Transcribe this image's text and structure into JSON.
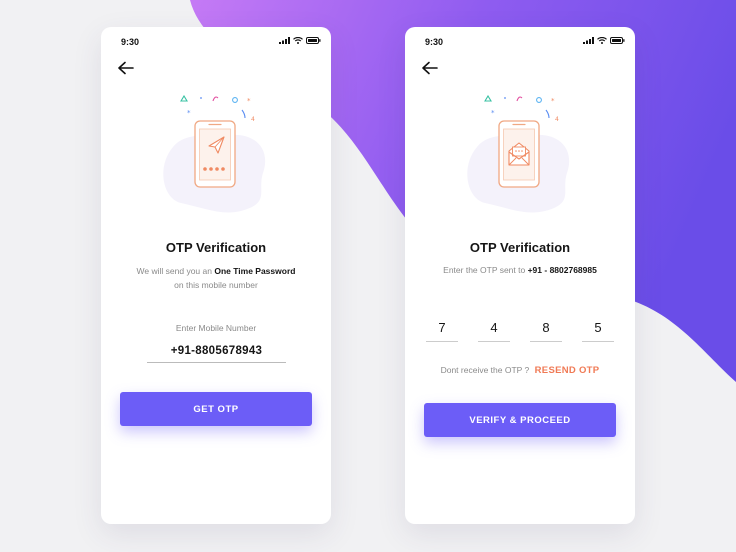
{
  "background": {
    "gradient_start": "#b36cf2",
    "gradient_end": "#6a4de8"
  },
  "phone_input_screen": {
    "status_time": "9:30",
    "title": "OTP Verification",
    "desc_prefix": "We will send you an",
    "desc_bold": "One Time Password",
    "desc_suffix": "on this mobile number",
    "input_label": "Enter Mobile Number",
    "phone_number": "+91-8805678943",
    "button_label": "GET OTP"
  },
  "otp_screen": {
    "status_time": "9:30",
    "title": "OTP Verification",
    "desc_prefix": "Enter the OTP sent to",
    "desc_number": "+91 - 8802768985",
    "otp_digits": [
      "7",
      "4",
      "8",
      "5"
    ],
    "resend_prompt": "Dont receive the OTP ?",
    "resend_label": "RESEND OTP",
    "button_label": "VERIFY & PROCEED"
  },
  "colors": {
    "primary": "#6c5df7",
    "accent": "#f07a55",
    "illustration": "#f0a883"
  },
  "icons": {
    "back": "arrow-left-icon",
    "signal": "signal-icon",
    "wifi": "wifi-icon",
    "battery": "battery-icon",
    "illustration_1": "paper-plane-phone-icon",
    "illustration_2": "envelope-phone-icon"
  }
}
